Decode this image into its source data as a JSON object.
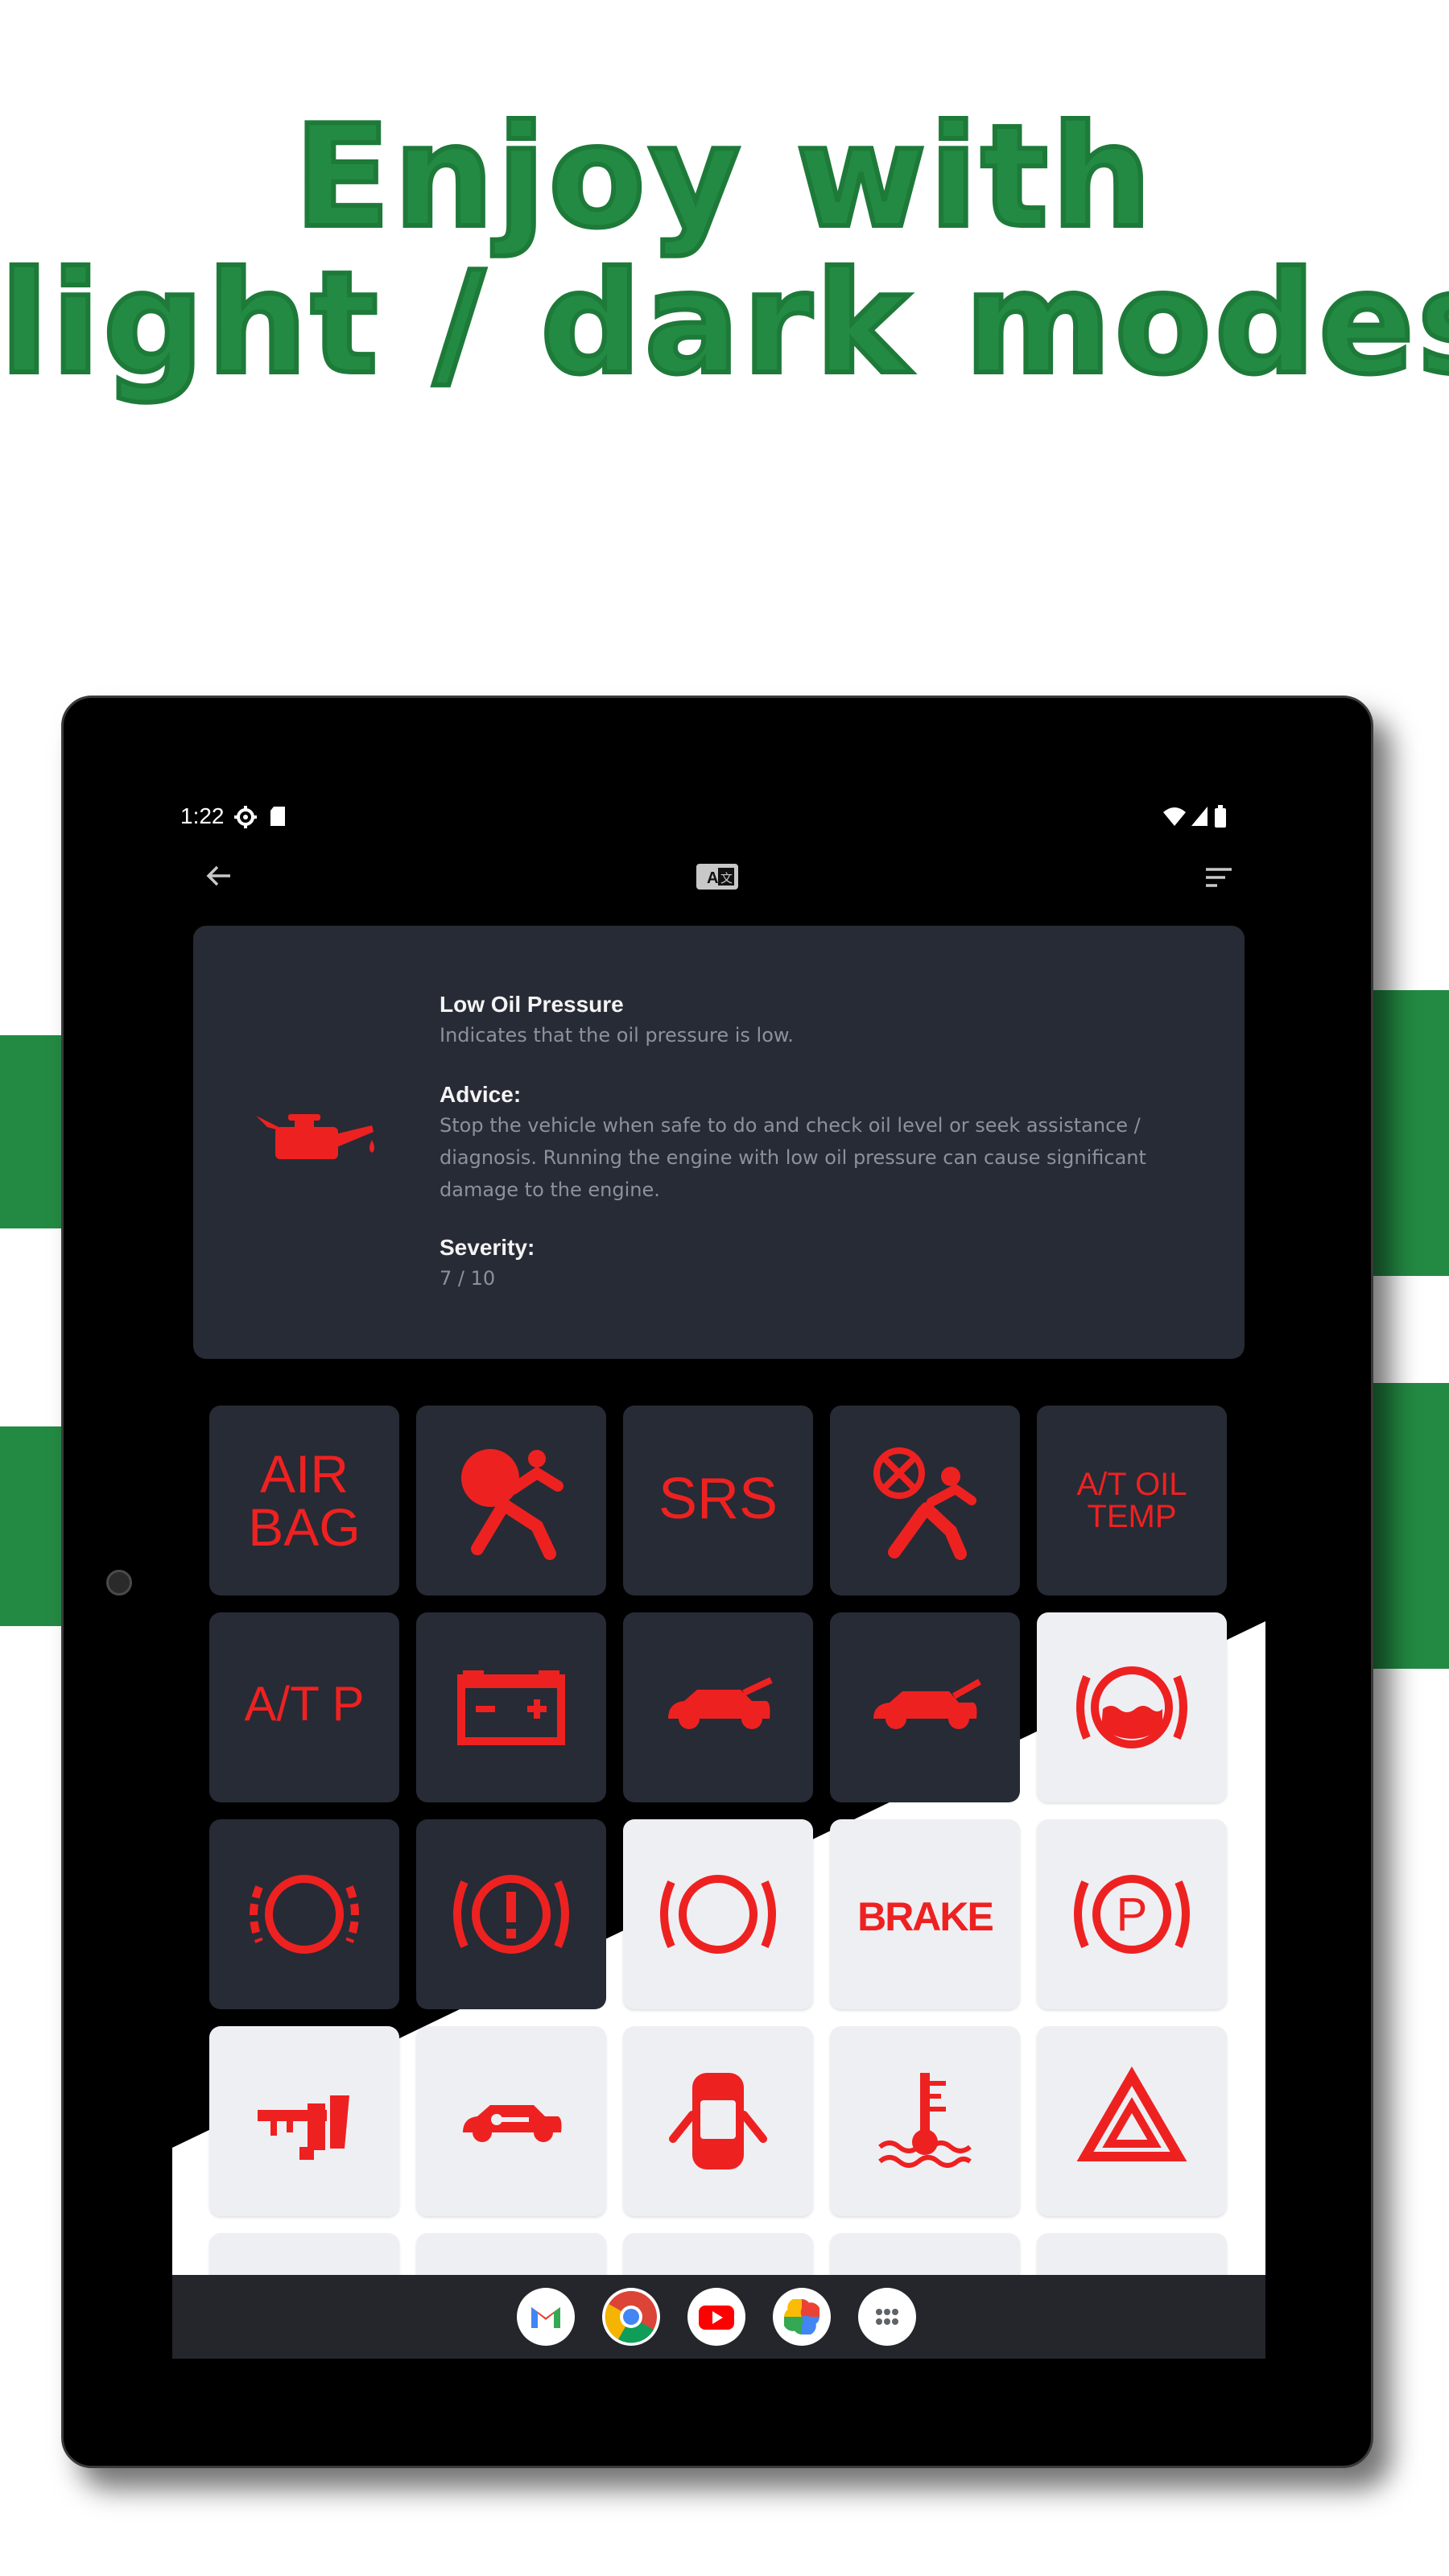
{
  "headline": {
    "line1": "Enjoy with",
    "line2": "light / dark modes"
  },
  "colors": {
    "green": "#238a43",
    "warning_red": "#ee2121",
    "card_dark": "#272b35",
    "tile_light": "#eeeff3"
  },
  "status_bar": {
    "time": "1:22",
    "icons": [
      "gear-icon",
      "sd-card-icon",
      "wifi-icon",
      "signal-icon",
      "battery-icon"
    ]
  },
  "app_bar": {
    "icons": [
      "back-arrow-icon",
      "translate-icon",
      "sort-icon"
    ]
  },
  "detail": {
    "title": "Low Oil Pressure",
    "description": "Indicates that the oil pressure is low.",
    "advice_label": "Advice:",
    "advice_text": "Stop the vehicle when safe to do and check oil level or seek assistance / diagnosis. Running the engine with low oil pressure can cause significant damage to the engine.",
    "severity_label": "Severity:",
    "severity_value": "7 / 10",
    "icon": "oil-can-icon"
  },
  "grid": {
    "row1": {
      "air_bag": "AIR BAG",
      "srs": "SRS",
      "at_oil_temp_1": "A/T OIL",
      "at_oil_temp_2": "TEMP"
    },
    "row2": {
      "atp": "A/T P"
    },
    "row3": {
      "brake": "BRAKE"
    }
  },
  "dock": {
    "apps": [
      "gmail-icon",
      "chrome-icon",
      "youtube-icon",
      "photos-icon",
      "app-drawer-icon"
    ]
  }
}
